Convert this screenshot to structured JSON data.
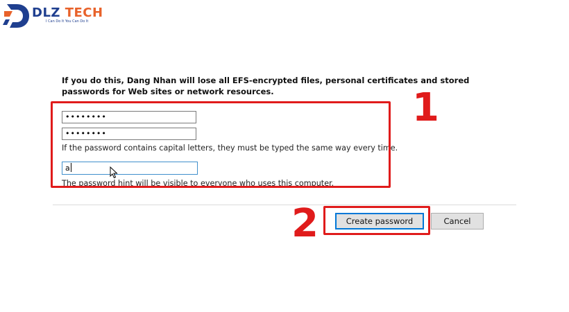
{
  "logo": {
    "name_part1": "DLZ",
    "name_part2": " TECH",
    "slogan": "I Can Do It You Can Do It",
    "icon": "dlz-logo-icon",
    "colors": {
      "primary": "#1f3f8f",
      "accent": "#e8622a"
    }
  },
  "dialog": {
    "warning": "If you do this, Dang Nhan will lose all EFS-encrypted files, personal certificates and stored passwords for Web sites or network resources.",
    "new_password_value": "••••••••",
    "confirm_password_value": "••••••••",
    "capital_letters_note": "If the password contains capital letters, they must be typed the same way every time.",
    "hint_value": "a",
    "hint_note": "The password hint will be visible to everyone who uses this computer.",
    "create_button_label": "Create password",
    "cancel_button_label": "Cancel"
  },
  "annotations": {
    "step1_label": "1",
    "step2_label": "2",
    "color": "#e01b1b"
  }
}
